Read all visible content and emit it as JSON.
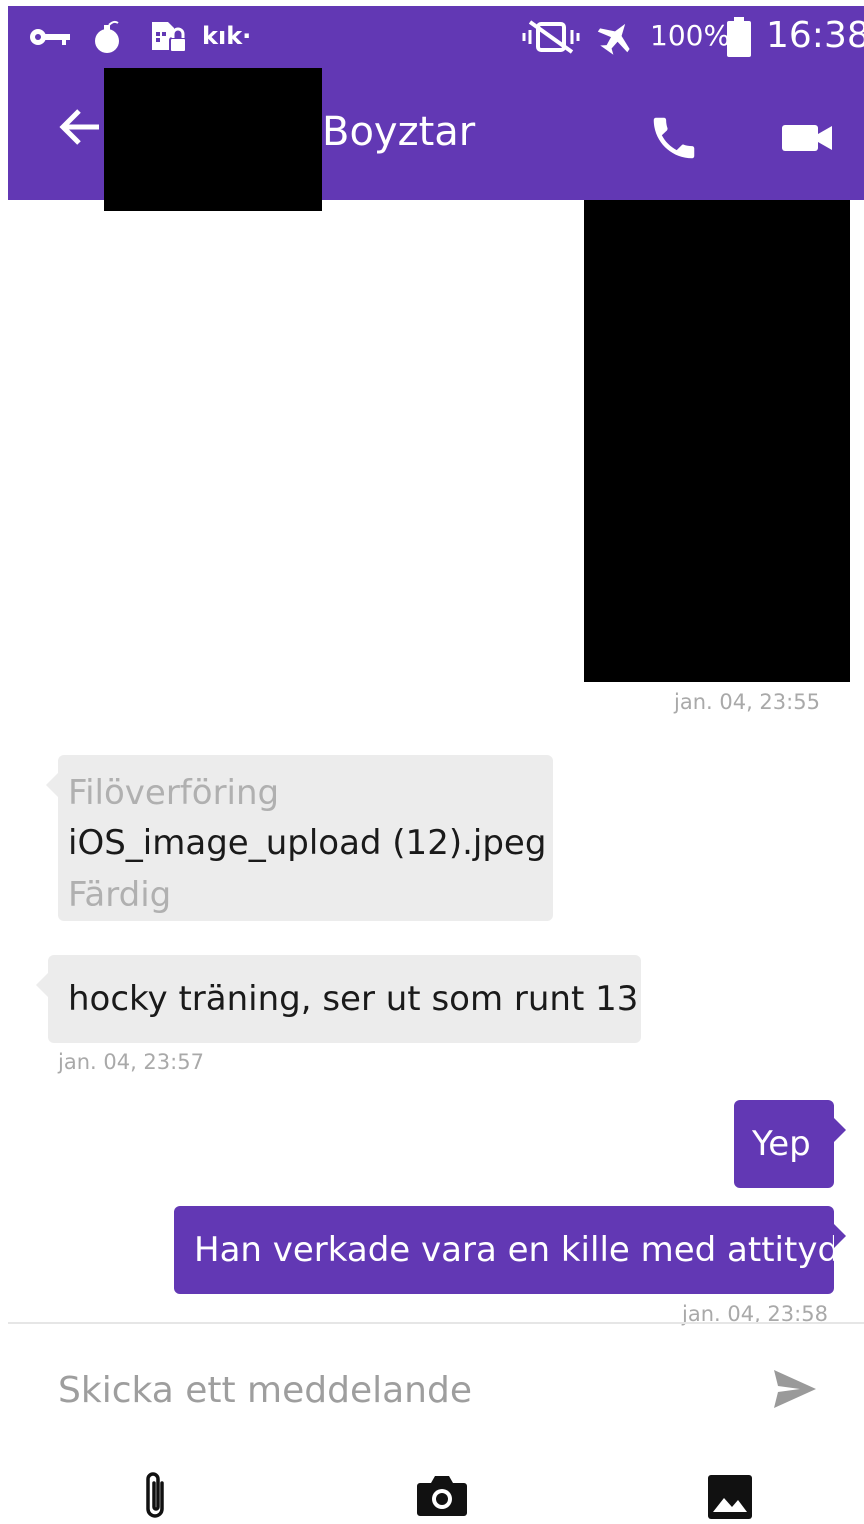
{
  "status_bar": {
    "app_label": "kık·",
    "battery": "100%",
    "time": "16:38",
    "icons": [
      "key-icon",
      "bomb-icon",
      "sim-lock-icon",
      "kik-icon",
      "vibrate-off-icon",
      "airplane-icon",
      "battery-icon"
    ]
  },
  "header": {
    "contact_name": "Boyztar",
    "icons": [
      "back-arrow-icon",
      "phone-icon",
      "video-call-icon"
    ]
  },
  "messages": [
    {
      "direction": "out",
      "type": "image",
      "timestamp": "jan. 04, 23:55"
    },
    {
      "direction": "in",
      "type": "file",
      "label": "Filöverföring",
      "filename": "iOS_image_upload (12).jpeg",
      "status": "Färdig"
    },
    {
      "direction": "in",
      "type": "text",
      "text": "hocky träning, ser ut som runt 13",
      "timestamp": "jan. 04, 23:57"
    },
    {
      "direction": "out",
      "type": "text",
      "text": "Yep"
    },
    {
      "direction": "out",
      "type": "text",
      "text": "Han verkade vara en kille med attityd",
      "timestamp": "jan. 04, 23:58"
    }
  ],
  "composer": {
    "placeholder": "Skicka ett meddelande",
    "icons": [
      "send-icon",
      "paperclip-icon",
      "camera-icon",
      "gallery-icon"
    ]
  },
  "colors": {
    "accent": "#6238b4",
    "incoming_bubble": "#ececec",
    "timestamp": "#a9a9a9"
  }
}
